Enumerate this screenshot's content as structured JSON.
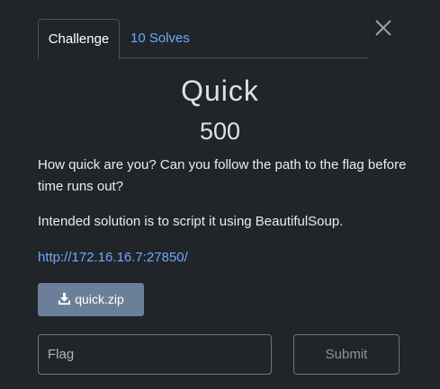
{
  "tabs": [
    {
      "label": "Challenge",
      "active": true
    },
    {
      "label": "10 Solves",
      "active": false
    }
  ],
  "challenge": {
    "name": "Quick",
    "value": "500",
    "description": [
      "How quick are you? Can you follow the path to the flag before time runs out?",
      "Intended solution is to script it using BeautifulSoup."
    ],
    "link": "http://172.16.16.7:27850/",
    "file": {
      "label": "quick.zip",
      "icon": "download-icon"
    }
  },
  "form": {
    "flag_placeholder": "Flag",
    "submit_label": "Submit"
  },
  "icons": {
    "close": "close-icon"
  },
  "colors": {
    "background": "#212529",
    "link": "#6ea8fe",
    "download_button": "#6c7f99",
    "border": "#6c757d"
  }
}
